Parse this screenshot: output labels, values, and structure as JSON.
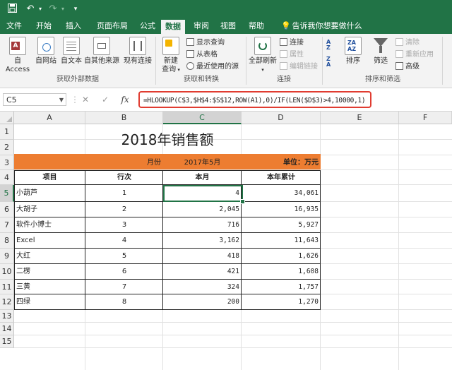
{
  "tabs": [
    "文件",
    "开始",
    "插入",
    "页面布局",
    "公式",
    "数据",
    "审阅",
    "视图",
    "帮助"
  ],
  "active_tab": "数据",
  "tell_me": "告诉我你想要做什么",
  "ribbon": {
    "get_external": {
      "buttons": [
        "自 Access",
        "自网站",
        "自文本",
        "自其他来源",
        "现有连接"
      ],
      "label": "获取外部数据"
    },
    "get_transform": {
      "new_query": [
        "新建",
        "查询"
      ],
      "small": [
        "显示查询",
        "从表格",
        "最近使用的源"
      ],
      "label": "获取和转换"
    },
    "connections": {
      "refresh_all": "全部刷新",
      "small": [
        "连接",
        "属性",
        "编辑链接"
      ],
      "label": "连接"
    },
    "sort_filter": {
      "sort": "排序",
      "filter": "筛选",
      "small": [
        "清除",
        "重新应用",
        "高级"
      ],
      "label": "排序和筛选"
    }
  },
  "formula_bar": {
    "name_box": "C5",
    "fx": "fx",
    "formula": "=HLOOKUP(C$3,$H$4:$S$12,ROW(A1),0)/IF(LEN($D$3)>4,10000,1)"
  },
  "columns": [
    "A",
    "B",
    "C",
    "D",
    "E",
    "F"
  ],
  "rows": [
    "1",
    "2",
    "3",
    "4",
    "5",
    "6",
    "7",
    "8",
    "9",
    "10",
    "11",
    "12",
    "13",
    "14",
    "15"
  ],
  "sheet": {
    "title": "2018年销售额",
    "band": {
      "month_label": "月份",
      "month_value": "2017年5月",
      "unit": "单位：万元"
    },
    "headers": [
      "项目",
      "行次",
      "本月",
      "本年累计"
    ],
    "data": [
      [
        "小葫芦",
        "1",
        "4",
        "34,061"
      ],
      [
        "大胡子",
        "2",
        "2,045",
        "16,935"
      ],
      [
        "软件小博士",
        "3",
        "716",
        "5,927"
      ],
      [
        "Excel",
        "4",
        "3,162",
        "11,643"
      ],
      [
        "大红",
        "5",
        "418",
        "1,626"
      ],
      [
        "二楞",
        "6",
        "421",
        "1,608"
      ],
      [
        "三黄",
        "7",
        "324",
        "1,757"
      ],
      [
        "四绿",
        "8",
        "200",
        "1,270"
      ]
    ]
  },
  "colors": {
    "excel_green": "#217346",
    "band_orange": "#ed7d31",
    "highlight_red": "#e03c31"
  }
}
